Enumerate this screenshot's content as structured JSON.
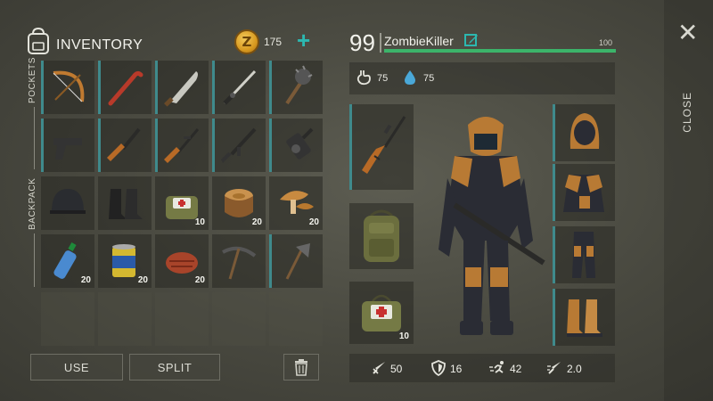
{
  "inventory": {
    "title": "INVENTORY",
    "coins": "175",
    "coin_letter": "Z",
    "pockets_label": "POCKETS",
    "backpack_label": "BACKPACK",
    "slots": [
      {
        "item": "bow",
        "qty": ""
      },
      {
        "item": "crowbar",
        "qty": ""
      },
      {
        "item": "machete",
        "qty": ""
      },
      {
        "item": "katana",
        "qty": ""
      },
      {
        "item": "spiked-club",
        "qty": ""
      },
      {
        "item": "pistol",
        "qty": ""
      },
      {
        "item": "shotgun",
        "qty": ""
      },
      {
        "item": "sniper-rifle",
        "qty": ""
      },
      {
        "item": "assault-rifle",
        "qty": ""
      },
      {
        "item": "grenade-launcher",
        "qty": ""
      },
      {
        "item": "helmet",
        "qty": ""
      },
      {
        "item": "boots",
        "qty": ""
      },
      {
        "item": "first-aid-kit",
        "qty": "10"
      },
      {
        "item": "log",
        "qty": "20"
      },
      {
        "item": "mushrooms",
        "qty": "20"
      },
      {
        "item": "water-bottle",
        "qty": "20"
      },
      {
        "item": "canned-beans",
        "qty": "20"
      },
      {
        "item": "steak",
        "qty": "20"
      },
      {
        "item": "pickaxe",
        "qty": ""
      },
      {
        "item": "hatchet",
        "qty": ""
      }
    ],
    "empty_slots": 5
  },
  "buttons": {
    "use": "USE",
    "split": "SPLIT"
  },
  "player": {
    "level": "99",
    "name": "ZombieKiller",
    "hp_max": "100",
    "hp_fraction": 1.0,
    "food": "75",
    "water": "75"
  },
  "equipment": {
    "weapon": "sniper-rifle",
    "backpack": "backpack",
    "medkit": "first-aid-kit",
    "medkit_qty": "10",
    "head": "hood",
    "chest": "jacket",
    "legs": "pants",
    "feet": "boots"
  },
  "stats": {
    "damage": "50",
    "defense": "16",
    "speed": "42",
    "attack_speed": "2.0"
  },
  "close": {
    "label": "CLOSE"
  },
  "colors": {
    "accent": "#2cb8b0",
    "slot_bar": "#3f8a8c",
    "hp": "#3cb46a"
  }
}
